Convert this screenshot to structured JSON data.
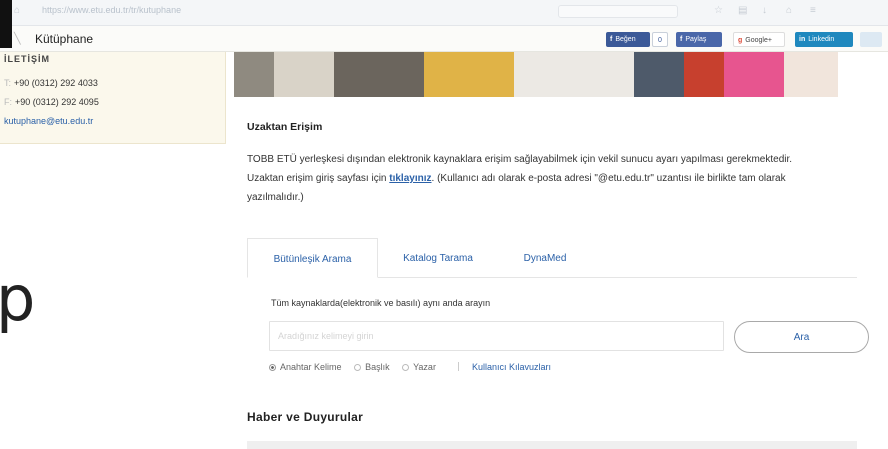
{
  "browser": {
    "url": "https://www.etu.edu.tr/tr/kutuphane"
  },
  "header": {
    "site_title": "Kütüphane",
    "share": {
      "fb_like": "Beğen",
      "fb_count": "0",
      "fb_share": "Paylaş",
      "gplus": "Google+",
      "linkedin": "Linkedin"
    }
  },
  "contact": {
    "title": "İLETİŞİM",
    "phone_prefix": "T:",
    "phone": "+90 (0312) 292 4033",
    "fax_prefix": "F:",
    "fax": "+90 (0312) 292 4095",
    "email": "kutuphane@etu.edu.tr"
  },
  "remote_access": {
    "title": "Uzaktan Erişim",
    "line1": "TOBB ETÜ yerleşkesi dışından elektronik kaynaklara erişim sağlayabilmek için vekil sunucu ayarı yapılması gerekmektedir.",
    "line2_pre": "Uzaktan erişim giriş sayfası için ",
    "link": "tıklayınız",
    "line2_post": ". (Kullanıcı adı olarak e-posta adresi \"@etu.edu.tr\" uzantısı ile birlikte tam olarak",
    "line3": "yazılmalıdır.)"
  },
  "search": {
    "tabs": [
      "Bütünleşik Arama",
      "Katalog Tarama",
      "DynaMed"
    ],
    "active_tab": 0,
    "hint": "Tüm kaynaklarda(elektronik ve basılı) aynı anda arayın",
    "placeholder": "Aradığınız kelimeyi girin",
    "button": "Ara",
    "radios": [
      "Anahtar Kelime",
      "Başlık",
      "Yazar"
    ],
    "selected_radio": 0,
    "guide_link": "Kullanıcı Kılavuzları"
  },
  "news": {
    "title": "Haber ve Duyurular"
  },
  "decor": {
    "big_letter": "p"
  },
  "colors": {
    "link_blue": "#2b61a8",
    "contact_bg": "#fbf8ec",
    "facebook": "#3b5998",
    "linkedin": "#1f88be"
  }
}
